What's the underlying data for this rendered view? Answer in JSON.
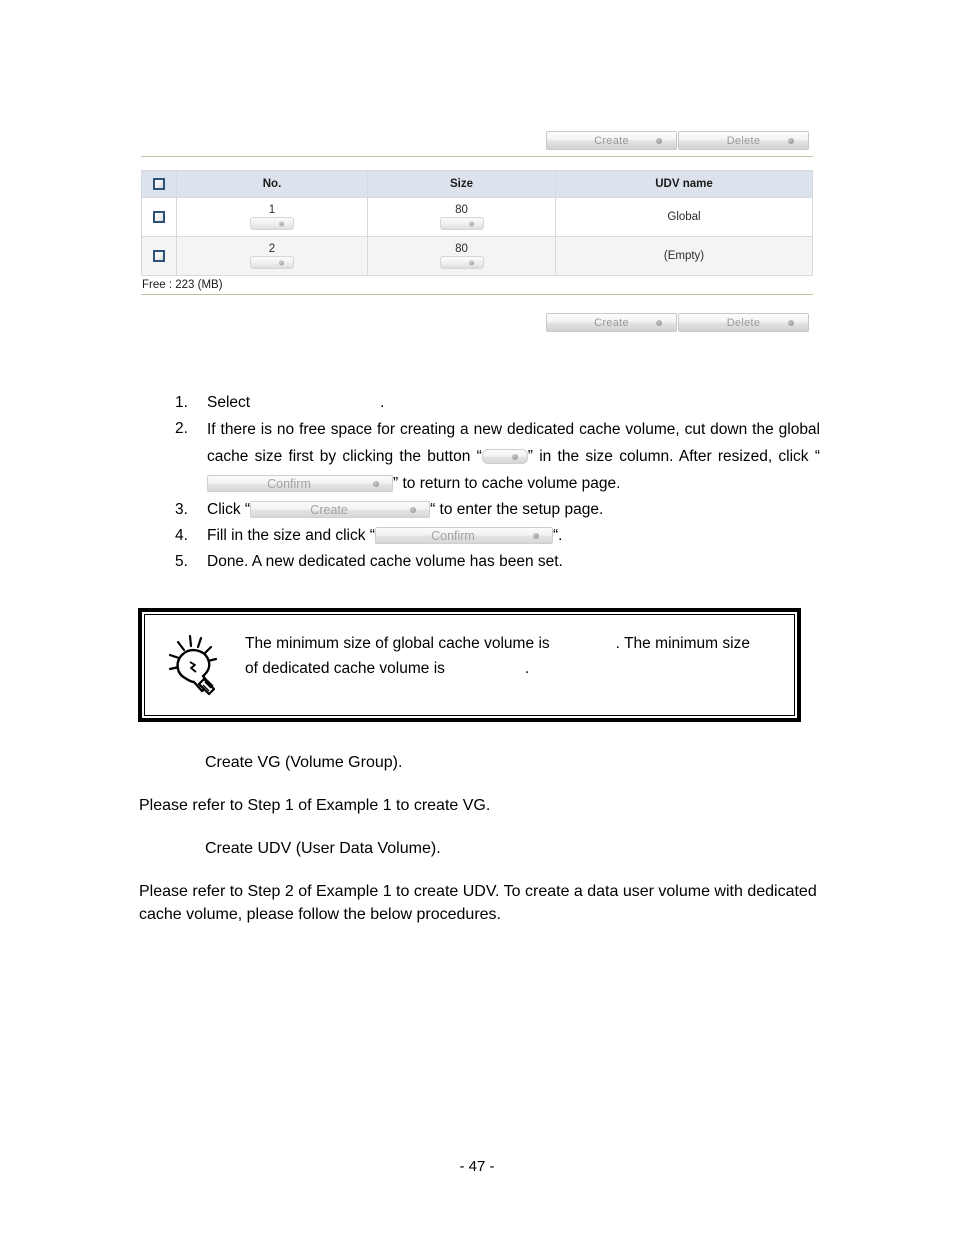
{
  "screenshot": {
    "top_toolbar": {
      "create_label": "Create",
      "delete_label": "Delete"
    },
    "bottom_toolbar": {
      "create_label": "Create",
      "delete_label": "Delete"
    },
    "table": {
      "headers": [
        "",
        "No.",
        "Size",
        "UDV name"
      ],
      "rows": [
        {
          "no": "1",
          "size": "80",
          "udv_name": "Global"
        },
        {
          "no": "2",
          "size": "80",
          "udv_name": "(Empty)"
        }
      ]
    },
    "free_space": "Free : 223 (MB)"
  },
  "steps": [
    {
      "num": "1.",
      "part1": "Select",
      "part2": "."
    },
    {
      "num": "2.",
      "part1": "If there is no free space for creating a new dedicated cache volume, cut down the global cache size first by clicking the button “",
      "part2": "” in the size column. After resized, click “",
      "btn2_label": "Confirm",
      "part3": "” to return to cache volume page."
    },
    {
      "num": "3.",
      "part1": "Click “",
      "btn_label": "Create",
      "part2": "“ to enter the setup page."
    },
    {
      "num": "4.",
      "part1": "Fill in the size and click “",
      "btn_label": "Confirm",
      "part2": "“."
    },
    {
      "num": "5.",
      "part1": "Done. A new dedicated cache volume has been set."
    }
  ],
  "note": {
    "icon": "lightbulb-icon",
    "text_part1": "The minimum size of global cache volume is",
    "text_part2": ". The minimum size of dedicated cache volume is",
    "text_part3": "."
  },
  "body": {
    "heading1": "Create VG (Volume Group).",
    "para1": "Please refer to Step 1 of Example 1 to create VG.",
    "heading2": "Create UDV (User Data Volume).",
    "para2": "Please refer to Step 2 of Example 1 to create UDV. To create a data user volume with dedicated cache volume, please follow the below procedures."
  },
  "footer": {
    "page_number": "- 47 -"
  },
  "colors": {
    "table_header_bg": "#dde3ec",
    "rule_line": "#c9bfa5",
    "checkbox_border": "#2c5279",
    "button_text": "#9a9a9a"
  }
}
